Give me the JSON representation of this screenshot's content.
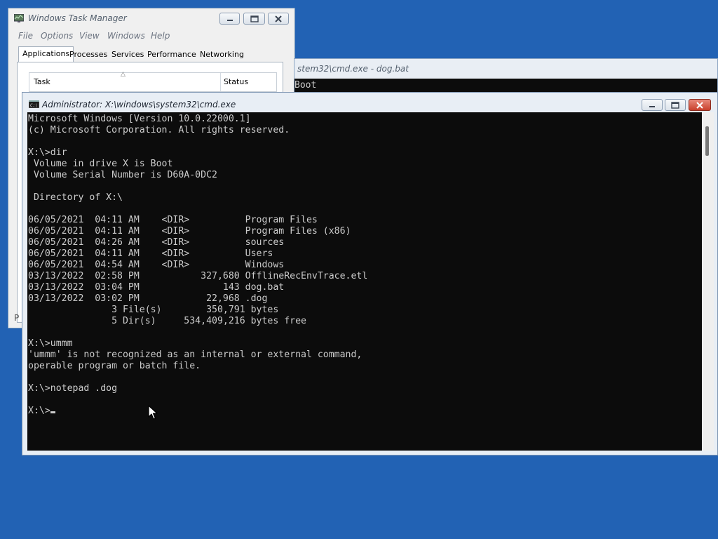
{
  "taskmanager": {
    "title": "Windows Task Manager",
    "menu": [
      "File",
      "Options",
      "View",
      "Windows",
      "Help"
    ],
    "tabs": [
      "Applications",
      "Processes",
      "Services",
      "Performance",
      "Networking"
    ],
    "active_tab": "Applications",
    "columns": [
      "Task",
      "Status"
    ],
    "bottom_text": "P"
  },
  "cmd_back": {
    "title": "stem32\\cmd.exe - dog.bat",
    "console_text": "Boot"
  },
  "cmd_front": {
    "title": "Administrator: X:\\windows\\system32\\cmd.exe",
    "lines": [
      "Microsoft Windows [Version 10.0.22000.1]",
      "(c) Microsoft Corporation. All rights reserved.",
      "",
      "X:\\>dir",
      " Volume in drive X is Boot",
      " Volume Serial Number is D60A-0DC2",
      "",
      " Directory of X:\\",
      "",
      "06/05/2021  04:11 AM    <DIR>          Program Files",
      "06/05/2021  04:11 AM    <DIR>          Program Files (x86)",
      "06/05/2021  04:26 AM    <DIR>          sources",
      "06/05/2021  04:11 AM    <DIR>          Users",
      "06/05/2021  04:54 AM    <DIR>          Windows",
      "03/13/2022  02:58 PM           327,680 OfflineRecEnvTrace.etl",
      "03/13/2022  03:04 PM               143 dog.bat",
      "03/13/2022  03:02 PM            22,968 .dog",
      "               3 File(s)        350,791 bytes",
      "               5 Dir(s)     534,409,216 bytes free",
      "",
      "X:\\>ummm",
      "'ummm' is not recognized as an internal or external command,",
      "operable program or batch file.",
      "",
      "X:\\>notepad .dog",
      ""
    ],
    "prompt": "X:\\>"
  },
  "colors": {
    "desktop": "#2262b4",
    "console_bg": "#0c0c0c",
    "console_fg": "#cccccc",
    "close_button": "#c8402c"
  },
  "icons": {
    "taskmgr": "task-manager-icon",
    "cmd": "cmd-icon",
    "minimize": "minimize-icon",
    "maximize": "maximize-icon",
    "close": "close-icon",
    "pointer": "mouse-pointer-icon"
  }
}
